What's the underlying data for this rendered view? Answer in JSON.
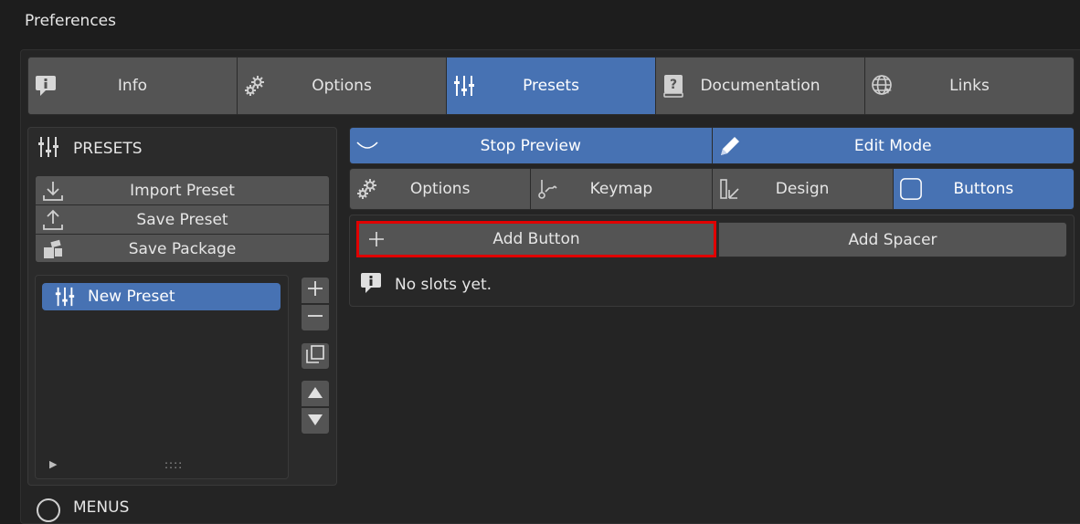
{
  "window": {
    "title": "Preferences"
  },
  "tabs": [
    {
      "label": "Info",
      "icon": "info-icon",
      "active": false
    },
    {
      "label": "Options",
      "icon": "gear-icon",
      "active": false
    },
    {
      "label": "Presets",
      "icon": "sliders-icon",
      "active": true
    },
    {
      "label": "Documentation",
      "icon": "help-book-icon",
      "active": false
    },
    {
      "label": "Links",
      "icon": "globe-icon",
      "active": false
    }
  ],
  "presets_panel": {
    "title": "PRESETS",
    "buttons": [
      {
        "label": "Import Preset",
        "icon": "import-icon"
      },
      {
        "label": "Save Preset",
        "icon": "export-icon"
      },
      {
        "label": "Save Package",
        "icon": "package-icon"
      }
    ],
    "list_items": [
      {
        "label": "New Preset",
        "icon": "sliders-icon",
        "selected": true
      }
    ],
    "grip": "::::"
  },
  "next_panel": {
    "title": "MENUS"
  },
  "preview_bar": {
    "stop_preview": "Stop Preview",
    "edit_mode": "Edit Mode"
  },
  "subtabs": [
    {
      "label": "Options",
      "icon": "gear-icon",
      "active": false
    },
    {
      "label": "Keymap",
      "icon": "keymap-icon",
      "active": false
    },
    {
      "label": "Design",
      "icon": "design-icon",
      "active": false
    },
    {
      "label": "Buttons",
      "icon": "checkbox-icon",
      "active": true
    }
  ],
  "content": {
    "add_button": "Add Button",
    "add_spacer": "Add Spacer",
    "empty_message": "No slots yet."
  },
  "colors": {
    "accent": "#4772b3",
    "highlight_box": "#e00000",
    "button": "#545454",
    "background": "#1d1d1d"
  }
}
